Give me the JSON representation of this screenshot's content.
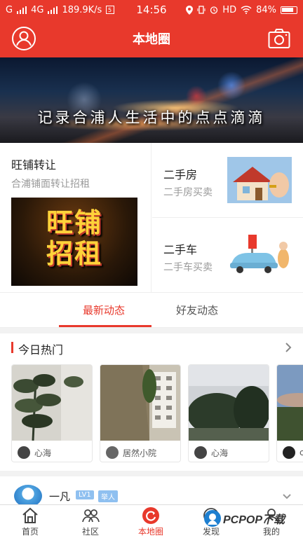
{
  "status_bar": {
    "carrier_1": "G",
    "carrier_2": "4G",
    "speed": "189.9K/s",
    "time": "14:56",
    "network_mode": "HD",
    "battery": "84%"
  },
  "header": {
    "title": "本地圈"
  },
  "banner": {
    "slogan": "记录合浦人生活中的点点滴滴"
  },
  "promo": {
    "left": {
      "title": "旺铺转让",
      "subtitle": "合浦铺面转让招租",
      "image_text_1": "旺铺",
      "image_text_2": "招租"
    },
    "right_top": {
      "title": "二手房",
      "subtitle": "二手房买卖"
    },
    "right_bottom": {
      "title": "二手车",
      "subtitle": "二手车买卖"
    }
  },
  "tabs": [
    {
      "label": "最新动态",
      "active": true
    },
    {
      "label": "好友动态",
      "active": false
    }
  ],
  "hot_today": {
    "title": "今日热门",
    "items": [
      {
        "user": "心海"
      },
      {
        "user": "居然小院"
      },
      {
        "user": "心海"
      },
      {
        "user": "c"
      }
    ]
  },
  "feed_preview": {
    "username": "一凡",
    "level": "LV1",
    "tag": "举人"
  },
  "tab_bar": [
    {
      "label": "首页",
      "icon": "home-icon",
      "active": false
    },
    {
      "label": "社区",
      "icon": "community-icon",
      "active": false
    },
    {
      "label": "本地圈",
      "icon": "local-circle-icon",
      "active": true
    },
    {
      "label": "发现",
      "icon": "discover-icon",
      "active": false
    },
    {
      "label": "我的",
      "icon": "profile-icon",
      "active": false
    }
  ],
  "watermark": {
    "text": "PCPOP下载"
  },
  "colors": {
    "accent": "#e8392c",
    "muted": "#999999"
  }
}
